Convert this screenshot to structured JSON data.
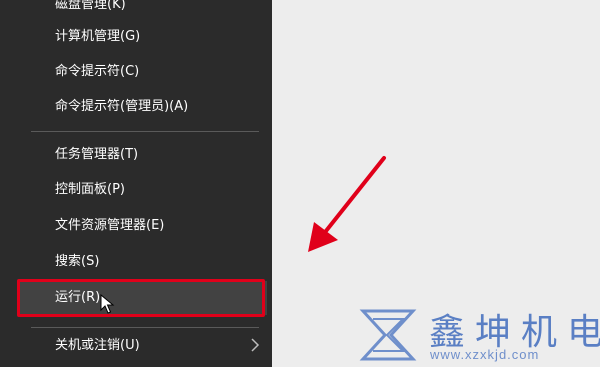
{
  "menu": {
    "items": [
      {
        "label": "磁盘管理(K)"
      },
      {
        "label": "计算机管理(G)"
      },
      {
        "label": "命令提示符(C)"
      },
      {
        "label": "命令提示符(管理员)(A)"
      },
      {
        "label": "任务管理器(T)"
      },
      {
        "label": "控制面板(P)"
      },
      {
        "label": "文件资源管理器(E)"
      },
      {
        "label": "搜索(S)"
      },
      {
        "label": "运行(R)"
      },
      {
        "label": "关机或注销(U)"
      }
    ]
  },
  "watermark": {
    "name": "鑫坤机电",
    "url": "www.xzxkjd.com"
  },
  "colors": {
    "menu_bg": "#2b2b2b",
    "highlight_box": "#e0001a",
    "arrow": "#e0001a",
    "watermark": "#5a7fc4"
  }
}
